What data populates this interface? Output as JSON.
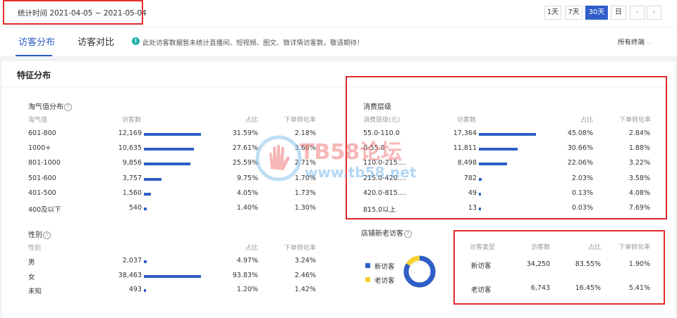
{
  "header": {
    "date_range": "统计时间 2021-04-05 ~ 2021-05-04",
    "range_buttons": [
      "1天",
      "7天",
      "30天",
      "日"
    ],
    "active_range": "30天",
    "prev_icon": "chevron-left-icon",
    "next_icon": "chevron-right-icon"
  },
  "tabs": {
    "items": [
      "访客分布",
      "访客对比"
    ],
    "active": "访客分布",
    "notice": "此处访客数据暂未统计直播间、短视频、图文、微详情访客数，敬请期待！",
    "terminal_select": "所有终端"
  },
  "section_title": "特征分布",
  "taoqi": {
    "title": "淘气值分布",
    "headers": [
      "淘气值",
      "访客数",
      "占比",
      "下单转化率"
    ],
    "rows": [
      {
        "label": "601-800",
        "visitors": "12,169",
        "pct": "31.59%",
        "conv": "2.18%",
        "share": 31.59
      },
      {
        "label": "1000+",
        "visitors": "10,635",
        "pct": "27.61%",
        "conv": "3.66%",
        "share": 27.61
      },
      {
        "label": "801-1000",
        "visitors": "9,856",
        "pct": "25.59%",
        "conv": "2.71%",
        "share": 25.59
      },
      {
        "label": "501-600",
        "visitors": "3,757",
        "pct": "9.75%",
        "conv": "1.70%",
        "share": 9.75
      },
      {
        "label": "401-500",
        "visitors": "1,560",
        "pct": "4.05%",
        "conv": "1.73%",
        "share": 4.05
      },
      {
        "label": "400及以下",
        "visitors": "540",
        "pct": "1.40%",
        "conv": "1.30%",
        "share": 1.4
      }
    ]
  },
  "consumption": {
    "title": "消费层级",
    "headers": [
      "消费层级(元)",
      "访客数",
      "占比",
      "下单转化率"
    ],
    "rows": [
      {
        "label": "55.0-110.0",
        "visitors": "17,364",
        "pct": "45.08%",
        "conv": "2.84%",
        "share": 45.08
      },
      {
        "label": "0-55.0",
        "visitors": "11,811",
        "pct": "30.66%",
        "conv": "1.88%",
        "share": 30.66
      },
      {
        "label": "110.0-215....",
        "visitors": "8,498",
        "pct": "22.06%",
        "conv": "3.22%",
        "share": 22.06
      },
      {
        "label": "215.0-420....",
        "visitors": "782",
        "pct": "2.03%",
        "conv": "3.58%",
        "share": 2.03
      },
      {
        "label": "420.0-815....",
        "visitors": "49",
        "pct": "0.13%",
        "conv": "4.08%",
        "share": 0.13
      },
      {
        "label": "815.0以上",
        "visitors": "13",
        "pct": "0.03%",
        "conv": "7.69%",
        "share": 0.03
      }
    ]
  },
  "gender": {
    "title": "性别",
    "headers": [
      "性别",
      "占比",
      "下单转化率"
    ],
    "rows": [
      {
        "label": "男",
        "visitors": "2,037",
        "pct": "4.97%",
        "conv": "3.24%",
        "share": 4.97
      },
      {
        "label": "女",
        "visitors": "38,463",
        "pct": "93.83%",
        "conv": "2.46%",
        "share": 93.83
      },
      {
        "label": "未知",
        "visitors": "493",
        "pct": "1.20%",
        "conv": "1.42%",
        "share": 1.2
      }
    ]
  },
  "shop_visitors": {
    "title": "店铺新老访客",
    "legend": [
      "新访客",
      "老访客"
    ],
    "colors": {
      "new": "#2e5ec8",
      "old": "#f5d132"
    },
    "headers": [
      "访客类型",
      "访客数",
      "占比",
      "下单转化率"
    ],
    "rows": [
      {
        "label": "新访客",
        "visitors": "34,250",
        "pct": "83.55%",
        "conv": "1.90%",
        "share": 83.55
      },
      {
        "label": "老访客",
        "visitors": "6,743",
        "pct": "16.45%",
        "conv": "5.41%",
        "share": 16.45
      }
    ]
  },
  "watermark": {
    "brand": "TB58论坛",
    "url": "www.tb58.net"
  },
  "colors": {
    "accent": "#2e5ec8",
    "annotation": "#e32b2b"
  }
}
